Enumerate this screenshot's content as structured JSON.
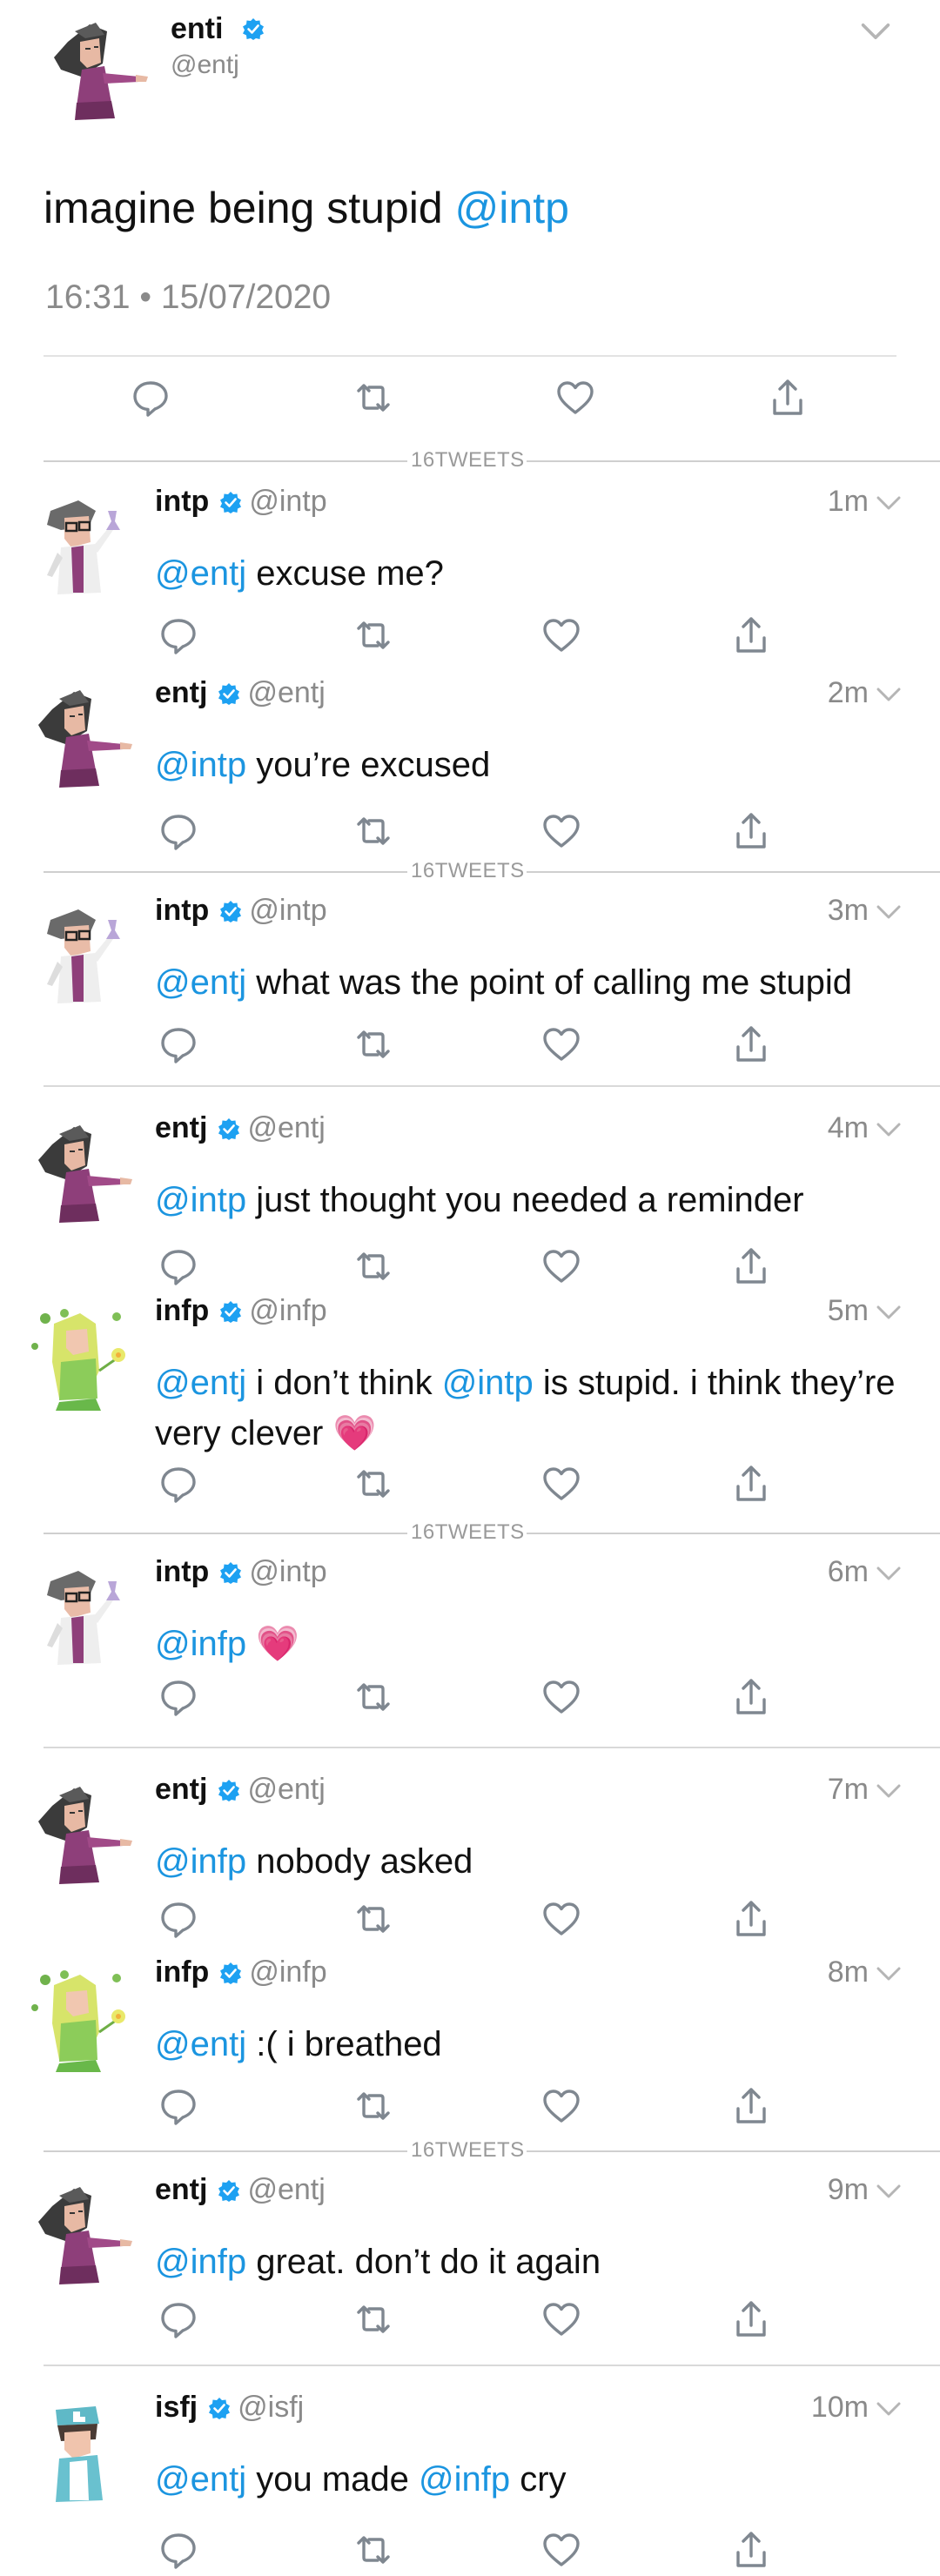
{
  "main_tweet": {
    "name": "enti",
    "handle": "@entj",
    "text_plain": "imagine being stupid ",
    "text_mention": "@intp",
    "timestamp": "16:31 • 15/07/2020"
  },
  "thread_marker": "16TWEETS",
  "colors": {
    "mention": "#1b95e0",
    "verified": "#1da1f2",
    "muted": "#8a8a8a"
  },
  "replies": [
    {
      "name": "intp",
      "handle": "@intp",
      "age": "1m",
      "avatar": "intp-avatar",
      "segments": [
        {
          "t": "@entj",
          "m": true
        },
        {
          "t": " excuse me?",
          "m": false
        }
      ]
    },
    {
      "name": "entj",
      "handle": "@entj",
      "age": "2m",
      "avatar": "entj-avatar",
      "segments": [
        {
          "t": "@intp",
          "m": true
        },
        {
          "t": " you’re excused",
          "m": false
        }
      ]
    },
    {
      "name": "intp",
      "handle": "@intp",
      "age": "3m",
      "avatar": "intp-avatar",
      "segments": [
        {
          "t": "@entj",
          "m": true
        },
        {
          "t": " what was the point of calling me stupid",
          "m": false
        }
      ]
    },
    {
      "name": "entj",
      "handle": "@entj",
      "age": "4m",
      "avatar": "entj-avatar",
      "segments": [
        {
          "t": "@intp",
          "m": true
        },
        {
          "t": " just thought you needed a reminder",
          "m": false
        }
      ]
    },
    {
      "name": "infp",
      "handle": "@infp",
      "age": "5m",
      "avatar": "infp-avatar",
      "segments": [
        {
          "t": "@entj",
          "m": true
        },
        {
          "t": " i don’t think ",
          "m": false
        },
        {
          "t": "@intp",
          "m": true
        },
        {
          "t": " is stupid. i think they’re very clever ",
          "m": false
        },
        {
          "t": "💗",
          "m": false
        }
      ]
    },
    {
      "name": "intp",
      "handle": "@intp",
      "age": "6m",
      "avatar": "intp-avatar",
      "segments": [
        {
          "t": "@infp",
          "m": true
        },
        {
          "t": " 💗",
          "m": false
        }
      ]
    },
    {
      "name": "entj",
      "handle": "@entj",
      "age": "7m",
      "avatar": "entj-avatar",
      "segments": [
        {
          "t": "@infp",
          "m": true
        },
        {
          "t": " nobody asked",
          "m": false
        }
      ]
    },
    {
      "name": "infp",
      "handle": "@infp",
      "age": "8m",
      "avatar": "infp-avatar",
      "segments": [
        {
          "t": "@entj",
          "m": true
        },
        {
          "t": " :( i breathed",
          "m": false
        }
      ]
    },
    {
      "name": "entj",
      "handle": "@entj",
      "age": "9m",
      "avatar": "entj-avatar",
      "segments": [
        {
          "t": "@infp",
          "m": true
        },
        {
          "t": " great. don’t do it again",
          "m": false
        }
      ]
    },
    {
      "name": "isfj",
      "handle": "@isfj",
      "age": "10m",
      "avatar": "isfj-avatar",
      "segments": [
        {
          "t": "@entj",
          "m": true
        },
        {
          "t": " you made ",
          "m": false
        },
        {
          "t": "@infp",
          "m": true
        },
        {
          "t": " cry",
          "m": false
        }
      ]
    }
  ]
}
